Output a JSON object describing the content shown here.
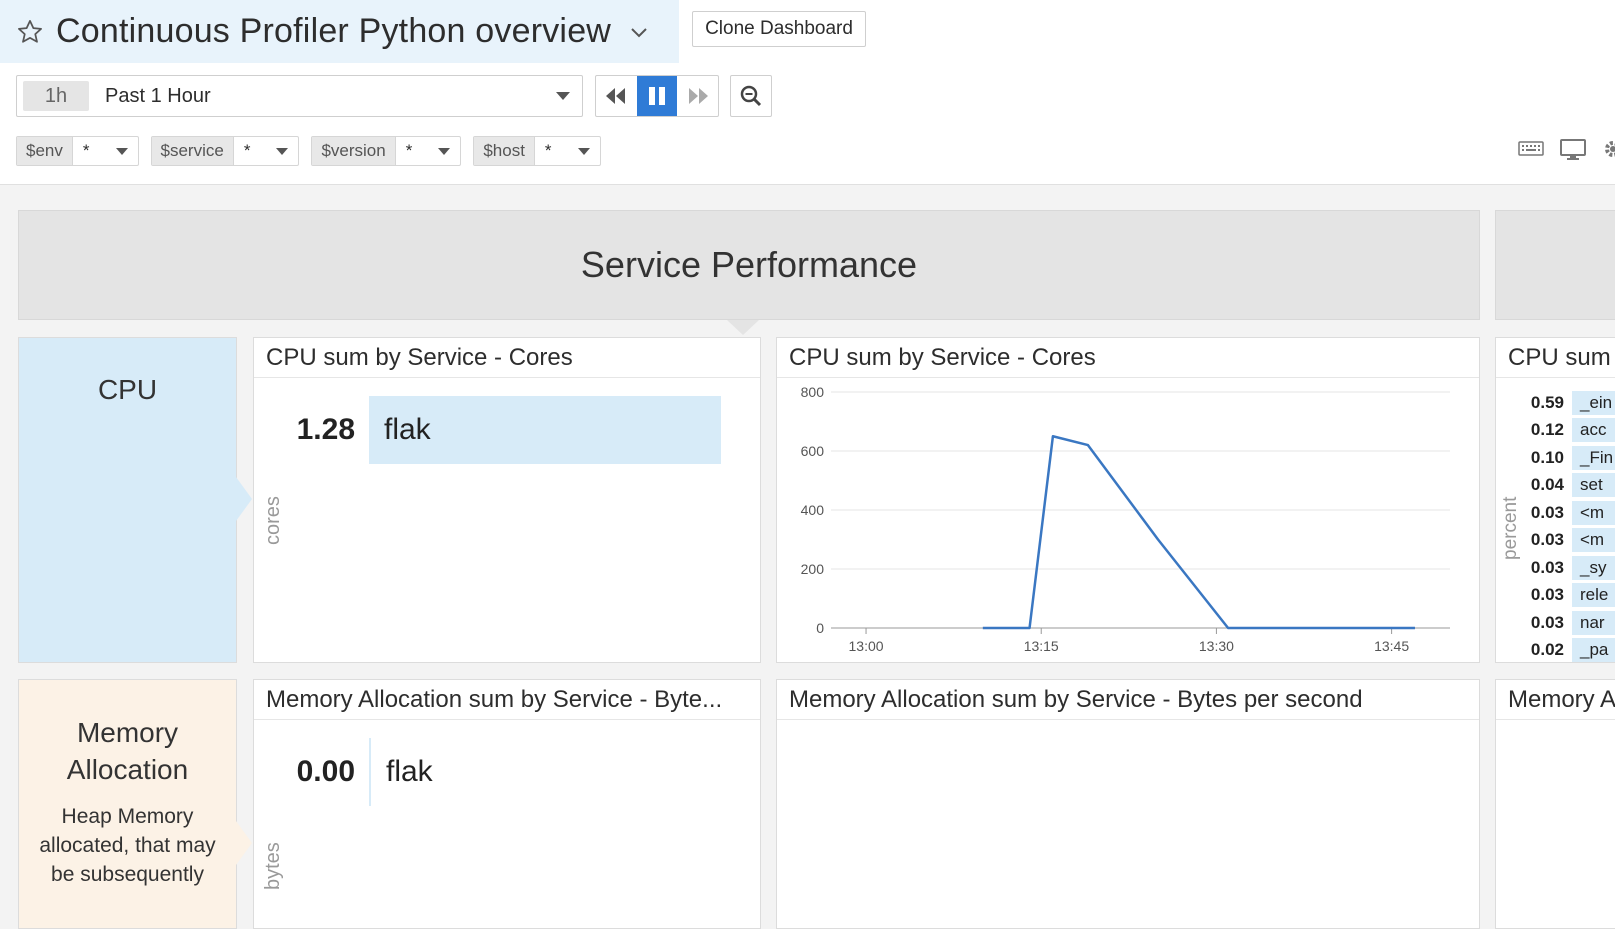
{
  "header": {
    "title": "Continuous Profiler Python overview",
    "clone_label": "Clone Dashboard",
    "time_badge": "1h",
    "time_label": "Past 1 Hour"
  },
  "template_vars": [
    {
      "name": "$env",
      "value": "*"
    },
    {
      "name": "$service",
      "value": "*"
    },
    {
      "name": "$version",
      "value": "*"
    },
    {
      "name": "$host",
      "value": "*"
    }
  ],
  "section": {
    "title": "Service Performance"
  },
  "notes": {
    "cpu": {
      "title": "CPU"
    },
    "memory": {
      "title_line1": "Memory",
      "title_line2": "Allocation",
      "desc": "Heap Memory allocated, that may be subsequently"
    }
  },
  "widgets": {
    "cpu_toplist": {
      "title": "CPU sum by Service - Cores",
      "unit": "cores",
      "rows": [
        {
          "value": "1.28",
          "label": "flak"
        }
      ]
    },
    "cpu_timeseries": {
      "title": "CPU sum by Service - Cores"
    },
    "cpu_toplist_right": {
      "title": "CPU sum",
      "unit": "percent",
      "rows": [
        {
          "value": "0.59",
          "label": "_ein"
        },
        {
          "value": "0.12",
          "label": "acc"
        },
        {
          "value": "0.10",
          "label": "_Fin"
        },
        {
          "value": "0.04",
          "label": "set"
        },
        {
          "value": "0.03",
          "label": "<m"
        },
        {
          "value": "0.03",
          "label": "<m"
        },
        {
          "value": "0.03",
          "label": "_sy"
        },
        {
          "value": "0.03",
          "label": "rele"
        },
        {
          "value": "0.03",
          "label": "nar"
        },
        {
          "value": "0.02",
          "label": "_pa"
        }
      ]
    },
    "mem_toplist": {
      "title": "Memory Allocation sum by Service - Byte...",
      "unit": "bytes",
      "rows": [
        {
          "value": "0.00",
          "label": "flak"
        }
      ]
    },
    "mem_timeseries": {
      "title": "Memory Allocation sum by Service - Bytes per second"
    },
    "mem_right": {
      "title": "Memory A"
    }
  },
  "chart_data": {
    "type": "line",
    "x": [
      "13:10",
      "13:13",
      "13:14",
      "13:16",
      "13:19",
      "13:25",
      "13:31",
      "13:40",
      "13:47"
    ],
    "series": [
      {
        "values": [
          0,
          0,
          0,
          650,
          620,
          300,
          0,
          0,
          0
        ]
      }
    ],
    "x_ticks": [
      "13:00",
      "13:15",
      "13:30",
      "13:45"
    ],
    "y_ticks": [
      "0",
      "200",
      "400",
      "600",
      "800"
    ],
    "ylim": [
      0,
      800
    ],
    "xlim": [
      "12:57",
      "13:50"
    ],
    "grid": true,
    "color": "#3a77c2"
  }
}
